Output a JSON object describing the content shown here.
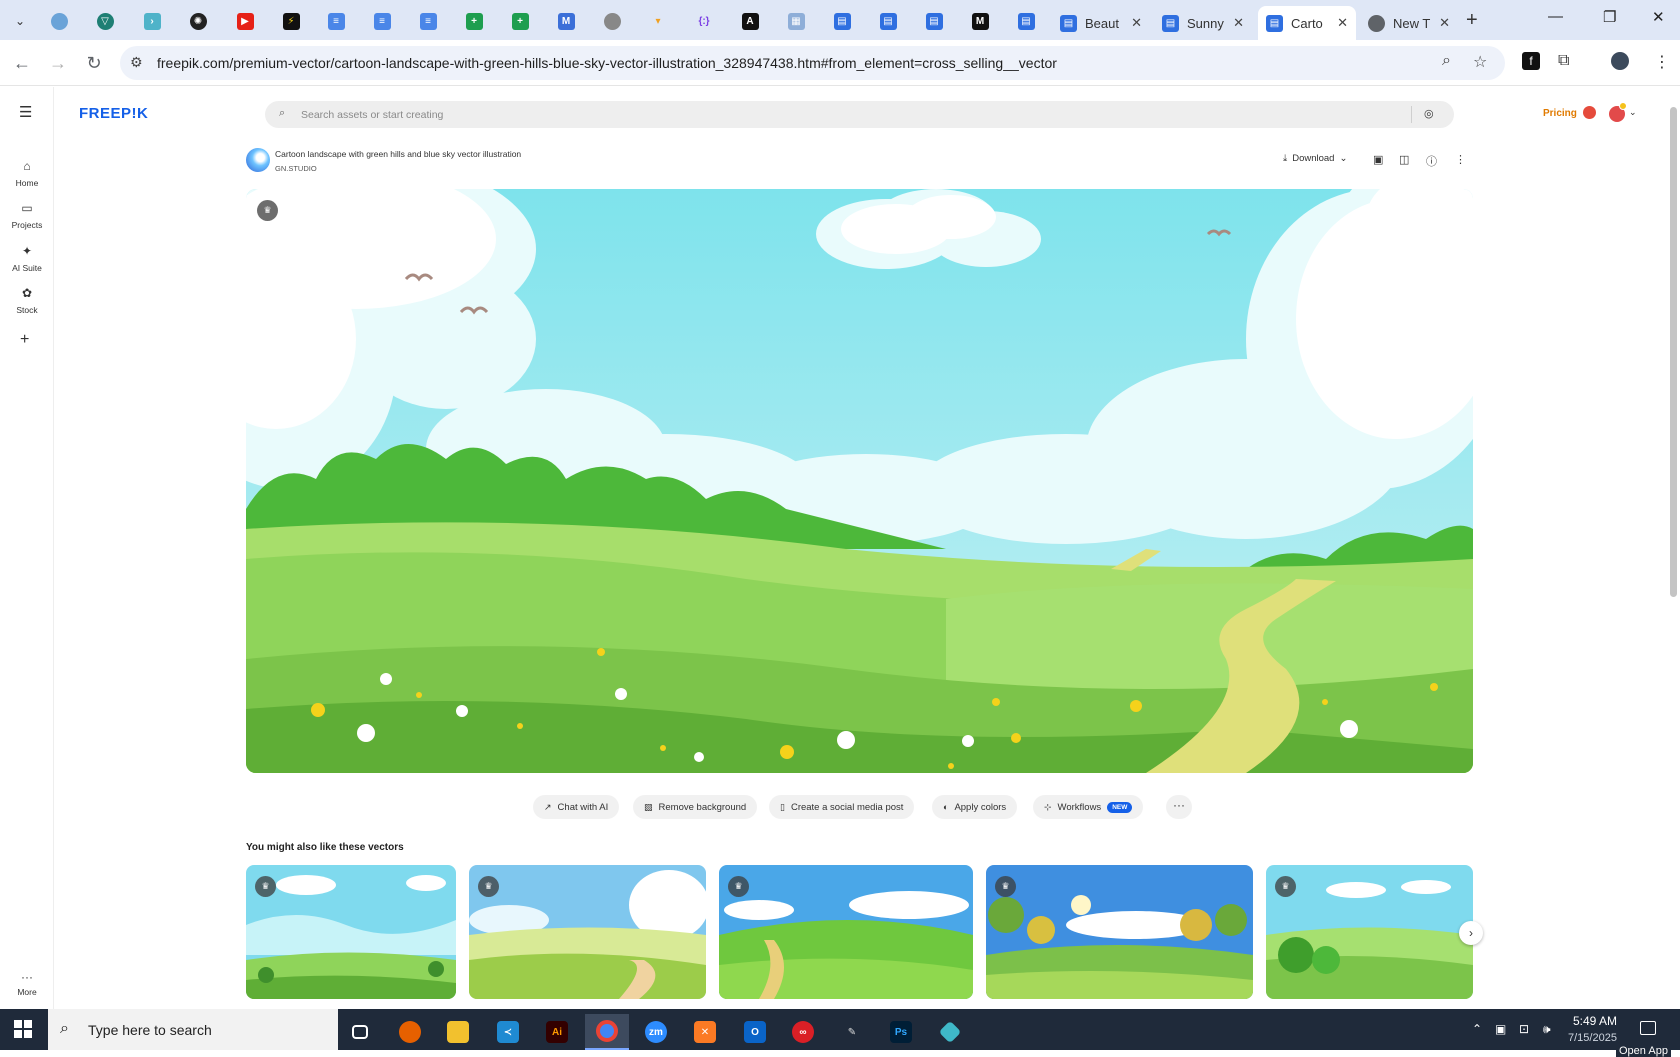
{
  "browser": {
    "tabs": [
      {
        "title": "Beaut",
        "favicon_color": "#1a73e8"
      },
      {
        "title": "Sunny",
        "favicon_color": "#1a73e8"
      },
      {
        "title": "Carto",
        "favicon_color": "#1a73e8",
        "active": true
      },
      {
        "title": "New T",
        "favicon_color": "#5f6368"
      }
    ],
    "url": "freepik.com/premium-vector/cartoon-landscape-with-green-hills-blue-sky-vector-illustration_328947438.htm#from_element=cross_selling__vector"
  },
  "header": {
    "logo": "FREEP!K",
    "search_placeholder": "Search assets or start creating",
    "pricing": "Pricing"
  },
  "sidebar": {
    "items": [
      {
        "label": "Home",
        "icon": "home-icon"
      },
      {
        "label": "Projects",
        "icon": "projects-icon"
      },
      {
        "label": "AI Suite",
        "icon": "ai-suite-icon"
      },
      {
        "label": "Stock",
        "icon": "stock-icon"
      }
    ],
    "more": "More"
  },
  "asset": {
    "title": "Cartoon landscape with green hills and blue sky vector illustration",
    "author": "GN.STUDIO",
    "download": "Download"
  },
  "tools": [
    {
      "label": "Chat with AI",
      "icon": "chat-icon"
    },
    {
      "label": "Remove background",
      "icon": "remove-bg-icon"
    },
    {
      "label": "Create a social media post",
      "icon": "phone-icon"
    },
    {
      "label": "Apply colors",
      "icon": "palette-icon"
    },
    {
      "label": "Workflows",
      "icon": "workflow-icon",
      "badge": "NEW"
    }
  ],
  "related": {
    "title": "You might also like these vectors"
  },
  "taskbar": {
    "search_text": "Type here to search",
    "time": "5:49 AM",
    "date": "7/15/2025",
    "open_app": "Open App"
  },
  "colors": {
    "brand": "#1560e8",
    "pricing": "#e07a00",
    "sky": "#8ee6ee",
    "grass": "#8fd45a"
  }
}
